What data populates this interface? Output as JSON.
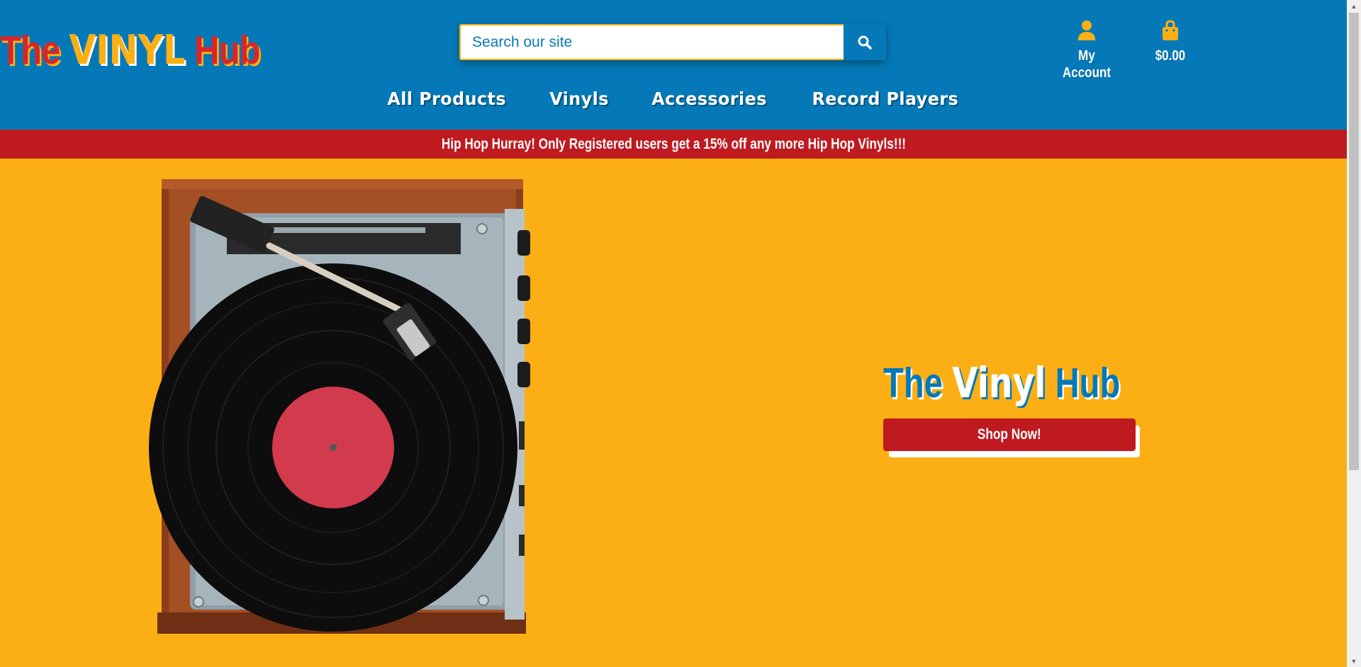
{
  "header": {
    "logo": {
      "part_the": "The ",
      "part_vinyl": "VINYL",
      "part_hub": " Hub"
    },
    "search": {
      "placeholder": "Search our site",
      "value": ""
    },
    "account_label": "My Account",
    "cart_total": "$0.00",
    "icons": {
      "search": "search-icon",
      "account": "user-icon",
      "cart": "shopping-bag-icon"
    }
  },
  "nav": {
    "items": [
      "All Products",
      "Vinyls",
      "Accessories",
      "Record Players"
    ]
  },
  "promo": {
    "text": "Hip Hop Hurray! Only Registered users get a 15% off any more Hip Hop Vinyls!!!"
  },
  "hero": {
    "title": {
      "part_the": "The ",
      "part_vinyl": "Vinyl",
      "part_hub": " Hub"
    },
    "button_label": "Shop Now!"
  },
  "colors": {
    "header_blue": "#0579b7",
    "accent_yellow": "#fbaf14",
    "banner_red": "#bf1a20",
    "logo_red": "#d7262c",
    "label_red": "#d23a4d"
  }
}
